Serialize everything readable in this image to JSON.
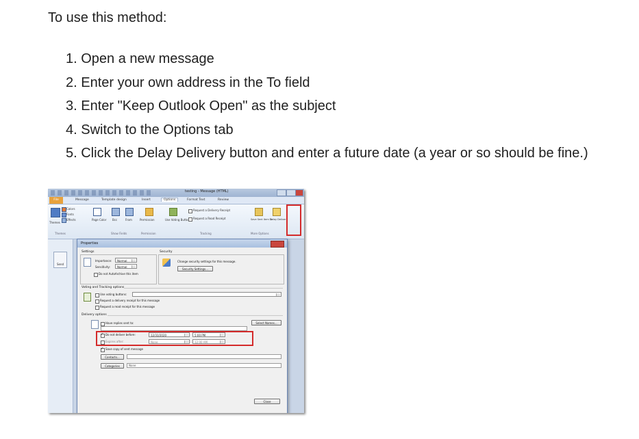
{
  "doc": {
    "intro": "To use this method:",
    "steps": [
      "1. Open a new message",
      "2. Enter your own address in the To field",
      "3. Enter \"Keep Outlook Open\" as the subject",
      "4. Switch to the Options tab",
      "5. Click the Delay Delivery button and enter a future date (a year or so should be fine.)"
    ]
  },
  "screenshot": {
    "window_title": "testing - Message (HTML)",
    "tabs": [
      "File",
      "Message",
      "Template design",
      "Insert",
      "Options",
      "Format Text",
      "Review"
    ],
    "ribbon": {
      "colors": "Colors",
      "fonts": "Fonts",
      "effects": "Effects",
      "themes": "Themes",
      "page_color": "Page Color",
      "bcc": "Bcc",
      "from": "From",
      "permission": "Permission",
      "use_voting": "Use Voting Buttons",
      "request_delivery": "Request a Delivery Receipt",
      "request_read": "Request a Read Receipt",
      "save_sent": "Save Sent Item To",
      "delay_delivery": "Delay Delivery",
      "group_themes": "Themes",
      "group_show_fields": "Show Fields",
      "group_permission": "Permission",
      "group_tracking": "Tracking",
      "group_more": "More Options"
    },
    "send": "Send",
    "dialog": {
      "title": "Properties",
      "settings": "Settings",
      "security": "Security",
      "importance_label": "Importance:",
      "importance_value": "Normal",
      "sensitivity_label": "Sensitivity:",
      "sensitivity_value": "Normal",
      "security_text": "Change security settings for this message.",
      "security_button": "Security Settings...",
      "autoarchive": "Do not AutoArchive this item",
      "voting_header": "Voting and Tracking options",
      "use_voting": "Use voting buttons:",
      "delivery_receipt": "Request a delivery receipt for this message",
      "read_receipt": "Request a read receipt for this message",
      "delivery_header": "Delivery options",
      "have_replies": "Have replies sent to:",
      "select_names": "Select Names...",
      "do_not_deliver": "Do not deliver before:",
      "deliver_date": "12/31/2020",
      "deliver_time": "5:00 PM",
      "expires_after": "Expires after:",
      "expires_date": "None",
      "expires_time": "12:00 AM",
      "save_copy": "Save copy of sent message",
      "contacts": "Contacts...",
      "categories": "Categories",
      "categories_value": "None",
      "close": "Close"
    }
  }
}
